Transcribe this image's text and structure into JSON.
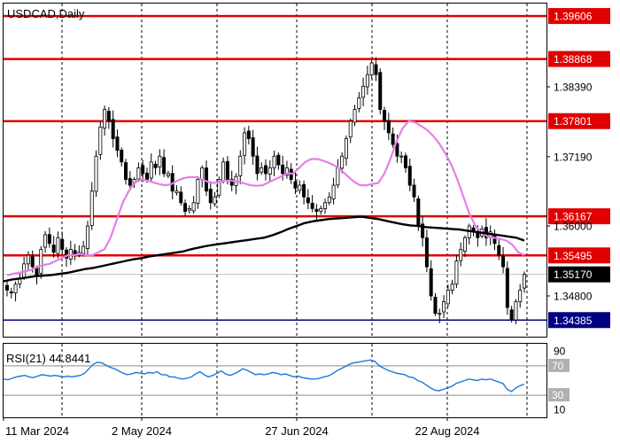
{
  "chart_data": [
    {
      "type": "candlestick",
      "title": "USDCAD,Daily",
      "x_ticks": [
        "11 Mar 2024",
        "2 May 2024",
        "27 Jun 2024",
        "22 Aug 2024"
      ],
      "y_tick_labels": [
        "1.38390",
        "1.37190",
        "1.36000",
        "1.34800"
      ],
      "ylim": [
        1.341,
        1.3982
      ],
      "levels": [
        {
          "label": "1.39606",
          "value": 1.39606,
          "color": "#e00000"
        },
        {
          "label": "1.38868",
          "value": 1.38868,
          "color": "#e00000"
        },
        {
          "label": "1.37801",
          "value": 1.37801,
          "color": "#e00000"
        },
        {
          "label": "1.36167",
          "value": 1.36167,
          "color": "#e00000"
        },
        {
          "label": "1.35495",
          "value": 1.35495,
          "color": "#e00000"
        },
        {
          "label": "1.34385",
          "value": 1.34385,
          "color": "#000080"
        }
      ],
      "current_price": {
        "label": "1.35170",
        "value": 1.3517,
        "color": "#000000"
      },
      "close": [
        1.349,
        1.3485,
        1.35,
        1.351,
        1.3535,
        1.355,
        1.353,
        1.3515,
        1.356,
        1.3585,
        1.357,
        1.3555,
        1.358,
        1.356,
        1.3545,
        1.356,
        1.355,
        1.3555,
        1.3565,
        1.36,
        1.366,
        1.372,
        1.377,
        1.38,
        1.378,
        1.375,
        1.373,
        1.371,
        1.368,
        1.367,
        1.368,
        1.37,
        1.369,
        1.368,
        1.371,
        1.37,
        1.372,
        1.369,
        1.369,
        1.366,
        1.366,
        1.364,
        1.3625,
        1.363,
        1.364,
        1.368,
        1.37,
        1.366,
        1.364,
        1.365,
        1.368,
        1.371,
        1.368,
        1.367,
        1.3685,
        1.372,
        1.376,
        1.375,
        1.372,
        1.369,
        1.37,
        1.369,
        1.37,
        1.372,
        1.3705,
        1.369,
        1.37,
        1.368,
        1.3665,
        1.367,
        1.365,
        1.364,
        1.363,
        1.3625,
        1.363,
        1.364,
        1.365,
        1.367,
        1.37,
        1.372,
        1.375,
        1.378,
        1.38,
        1.382,
        1.384,
        1.386,
        1.388,
        1.386,
        1.38,
        1.378,
        1.376,
        1.374,
        1.372,
        1.372,
        1.37,
        1.367,
        1.365,
        1.36,
        1.358,
        1.353,
        1.348,
        1.345,
        1.345,
        1.347,
        1.349,
        1.35,
        1.354,
        1.356,
        1.358,
        1.36,
        1.359,
        1.358,
        1.3595,
        1.358,
        1.359,
        1.357,
        1.355,
        1.353,
        1.346,
        1.344,
        1.347,
        1.349,
        1.3517
      ],
      "sma_pink": [
        1.3515,
        1.3518,
        1.352,
        1.3522,
        1.3525,
        1.353,
        1.3533,
        1.3535,
        1.354,
        1.3545,
        1.355,
        1.355,
        1.3552,
        1.355,
        1.355,
        1.3555,
        1.356,
        1.358,
        1.361,
        1.364,
        1.366,
        1.3675,
        1.368,
        1.3678,
        1.3675,
        1.3672,
        1.367,
        1.3672,
        1.3678,
        1.3682,
        1.3684,
        1.3684,
        1.368,
        1.3676,
        1.3674,
        1.3676,
        1.3678,
        1.3678,
        1.3676,
        1.3673,
        1.367,
        1.3669,
        1.367,
        1.3675,
        1.368,
        1.3685,
        1.369,
        1.369,
        1.37,
        1.371,
        1.3715,
        1.3715,
        1.3712,
        1.3708,
        1.3703,
        1.3695,
        1.3685,
        1.3676,
        1.367,
        1.367,
        1.3672,
        1.3674,
        1.369,
        1.3715,
        1.3745,
        1.3768,
        1.378,
        1.3778,
        1.3772,
        1.3765,
        1.3755,
        1.3742,
        1.3725,
        1.3705,
        1.368,
        1.365,
        1.362,
        1.36,
        1.3588,
        1.3582,
        1.358,
        1.3578,
        1.3575,
        1.3568,
        1.3555,
        1.355
      ],
      "sma_black": [
        1.3505,
        1.3508,
        1.351,
        1.3512,
        1.3514,
        1.3515,
        1.3516,
        1.3518,
        1.352,
        1.3523,
        1.3526,
        1.3528,
        1.3531,
        1.3534,
        1.3537,
        1.354,
        1.3543,
        1.3545,
        1.3548,
        1.355,
        1.3552,
        1.3554,
        1.3556,
        1.356,
        1.3563,
        1.3566,
        1.3568,
        1.357,
        1.3572,
        1.3574,
        1.3576,
        1.3578,
        1.358,
        1.3584,
        1.3589,
        1.3595,
        1.36,
        1.3605,
        1.3608,
        1.361,
        1.3612,
        1.3613,
        1.3614,
        1.3615,
        1.3616,
        1.3614,
        1.3612,
        1.3609,
        1.3606,
        1.3603,
        1.3601,
        1.36,
        1.3598,
        1.3597,
        1.3596,
        1.3595,
        1.3594,
        1.3592,
        1.359,
        1.3588,
        1.3586,
        1.3584,
        1.3582,
        1.358,
        1.3575
      ],
      "rsi": {
        "label": "RSI(21) 44.8441",
        "levels": [
          {
            "label": "70",
            "value": 70
          },
          {
            "label": "30",
            "value": 30
          }
        ],
        "scale_labels": [
          "90",
          "10"
        ],
        "values": [
          52,
          51,
          53,
          55,
          56,
          57,
          55,
          54,
          56,
          58,
          57,
          56,
          57,
          56,
          55,
          56,
          55,
          56,
          57,
          60,
          66,
          72,
          75,
          74,
          71,
          68,
          66,
          63,
          60,
          58,
          59,
          61,
          60,
          59,
          61,
          60,
          62,
          58,
          58,
          55,
          55,
          53,
          52,
          53,
          55,
          59,
          62,
          58,
          55,
          57,
          60,
          63,
          59,
          57,
          59,
          62,
          66,
          64,
          61,
          58,
          59,
          58,
          59,
          61,
          60,
          58,
          59,
          57,
          55,
          56,
          54,
          53,
          52,
          52,
          53,
          55,
          56,
          59,
          63,
          66,
          69,
          72,
          74,
          75,
          76,
          77,
          78,
          76,
          70,
          67,
          64,
          62,
          60,
          59,
          58,
          55,
          54,
          50,
          48,
          44,
          40,
          37,
          36,
          38,
          40,
          42,
          46,
          48,
          50,
          52,
          51,
          50,
          52,
          51,
          52,
          50,
          48,
          46,
          38,
          35,
          40,
          43,
          45
        ]
      }
    }
  ]
}
